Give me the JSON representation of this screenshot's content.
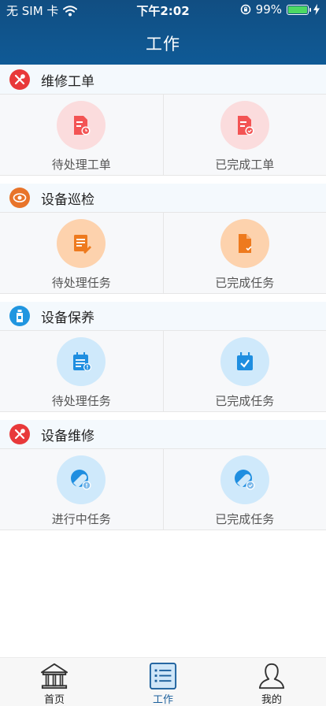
{
  "status_bar": {
    "carrier": "无 SIM 卡",
    "time": "下午2:02",
    "battery": "99%"
  },
  "header": {
    "title": "工作"
  },
  "colors": {
    "header_bg": "#114e82",
    "accent": "#1b5f9c",
    "repair_red": "#e8393a",
    "inspect_orange": "#e8742a",
    "maint_blue": "#2196e0"
  },
  "sections": [
    {
      "title": "维修工单",
      "icon": "wrench-screwdriver-icon",
      "items": [
        {
          "label": "待处理工单",
          "icon": "pending-document-icon"
        },
        {
          "label": "已完成工单",
          "icon": "completed-document-icon"
        }
      ]
    },
    {
      "title": "设备巡检",
      "icon": "eye-icon",
      "items": [
        {
          "label": "待处理任务",
          "icon": "pending-note-icon"
        },
        {
          "label": "已完成任务",
          "icon": "completed-file-icon"
        }
      ]
    },
    {
      "title": "设备保养",
      "icon": "oil-bottle-icon",
      "items": [
        {
          "label": "待处理任务",
          "icon": "pending-calendar-icon"
        },
        {
          "label": "已完成任务",
          "icon": "completed-calendar-icon"
        }
      ]
    },
    {
      "title": "设备维修",
      "icon": "wrench-screwdriver-icon",
      "items": [
        {
          "label": "进行中任务",
          "icon": "in-progress-wrench-icon"
        },
        {
          "label": "已完成任务",
          "icon": "completed-wrench-icon"
        }
      ]
    }
  ],
  "tabbar": [
    {
      "label": "首页",
      "icon": "home-building-icon"
    },
    {
      "label": "工作",
      "icon": "work-list-icon",
      "active": true
    },
    {
      "label": "我的",
      "icon": "user-profile-icon"
    }
  ]
}
